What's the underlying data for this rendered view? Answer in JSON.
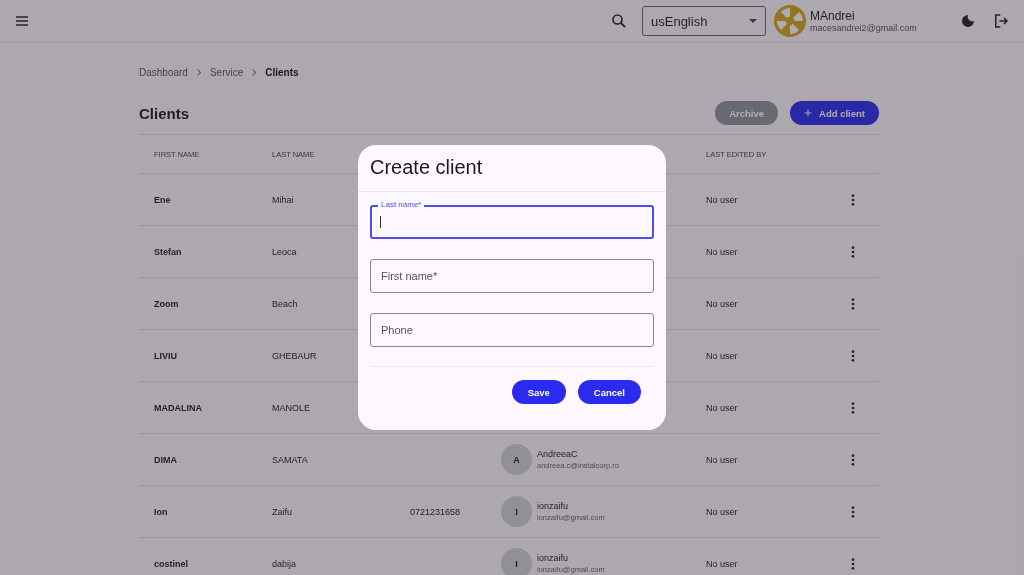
{
  "header": {
    "language": "usEnglish",
    "user": {
      "name": "MAndrei",
      "email": "macesandrei2@gmail.com"
    }
  },
  "breadcrumb": [
    {
      "label": "Dashboard",
      "current": false
    },
    {
      "label": "Service",
      "current": false
    },
    {
      "label": "Clients",
      "current": true
    }
  ],
  "page_title": "Clients",
  "actions": {
    "archive": "Archive",
    "add": "Add client"
  },
  "table": {
    "columns": {
      "first_name": "FIRST NAME",
      "last_name": "LAST NAME",
      "last_edited_by": "LAST EDITED BY"
    },
    "rows": [
      {
        "first_name": "Ene",
        "last_name": "Mihai",
        "last_edited_by": "No user"
      },
      {
        "first_name": "Stefan",
        "last_name": "Leoca",
        "last_edited_by": "No user"
      },
      {
        "first_name": "Zoom",
        "last_name": "Beach",
        "last_edited_by": "No user"
      },
      {
        "first_name": "LIVIU",
        "last_name": "GHEBAUR",
        "last_edited_by": "No user"
      },
      {
        "first_name": "MADALINA",
        "last_name": "MANOLE",
        "last_edited_by": "No user"
      },
      {
        "first_name": "DIMA",
        "last_name": "SAMATA",
        "user": {
          "initial": "A",
          "name": "AndreeaC",
          "email": "andreea.c@instalcorp.ro"
        },
        "last_edited_by": "No user"
      },
      {
        "first_name": "Ion",
        "last_name": "Zaifu",
        "phone": "0721231658",
        "user": {
          "initial": "I",
          "name": "ionzaifu",
          "email": "ionzaifu@gmail.com"
        },
        "last_edited_by": "No user"
      },
      {
        "first_name": "costinel",
        "last_name": "dabija",
        "user": {
          "initial": "I",
          "name": "ionzaifu",
          "email": "ionzaifu@gmail.com"
        },
        "last_edited_by": "No user"
      }
    ]
  },
  "dialog": {
    "title": "Create client",
    "fields": [
      {
        "label": "Last name*",
        "focused": true
      },
      {
        "label": "First name*",
        "focused": false
      },
      {
        "label": "Phone",
        "focused": false
      }
    ],
    "buttons": [
      "Save",
      "Cancel"
    ]
  }
}
